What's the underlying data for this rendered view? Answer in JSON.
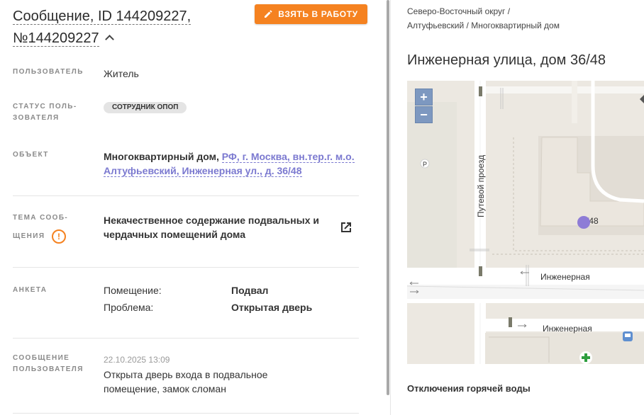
{
  "message": {
    "title": "Сообщение, ID 144209227, №144209227",
    "take_button": "ВЗЯТЬ В РАБОТУ"
  },
  "fields": {
    "user_label": "ПОЛЬЗОВАТЕЛЬ",
    "user_value": "Житель",
    "status_label_1": "СТАТУС ПОЛЬ-",
    "status_label_2": "ЗОВАТЕЛЯ",
    "status_value": "СОТРУДНИК ОПОП",
    "object_label": "ОБЪЕКТ",
    "object_prefix": "Многоквартирный дом,",
    "object_link_1": "РФ, г. Москва, вн.тер.г. м.о.",
    "object_link_2": "Алтуфьевский, Инженерная ул., д. 36/48",
    "topic_label_1": "ТЕМА СООБ-",
    "topic_label_2": "ЩЕНИЯ",
    "topic_value_1": "Некачественное содержание подвальных и",
    "topic_value_2": "чердачных помещений дома",
    "form_label": "АНКЕТА",
    "form_rows": [
      {
        "key": "Помещение:",
        "value": "Подвал"
      },
      {
        "key": "Проблема:",
        "value": "Открытая дверь"
      }
    ],
    "msg_label_1": "СООБЩЕНИЕ",
    "msg_label_2": "ПОЛЬЗОВАТЕЛЯ",
    "msg_date": "22.10.2025 13:09",
    "msg_text_1": "Открыта дверь входа в подвальное",
    "msg_text_2": "помещение, замок сломан"
  },
  "right": {
    "breadcrumb_1": "Северо-Восточный округ /",
    "breadcrumb_2": "Алтуфьевский / Многоквартирный дом",
    "address": "Инженерная улица, дом 36/48",
    "map": {
      "zoom_in": "+",
      "zoom_out": "−",
      "street_1": "Путевой проезд",
      "street_2": "Инженерная",
      "street_3": "Инженерная",
      "house_number": "/48",
      "parking": "P",
      "marker_color": "#8e7cd6"
    },
    "outage_title": "Отключения горячей воды"
  },
  "colors": {
    "accent": "#f58220",
    "link": "#7b79d0"
  }
}
